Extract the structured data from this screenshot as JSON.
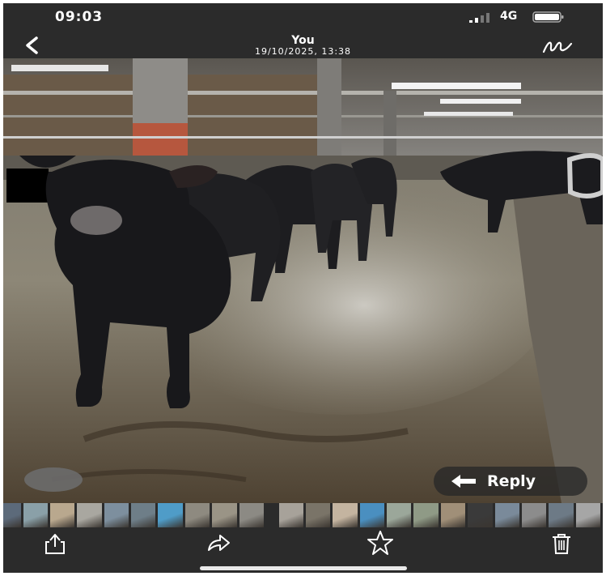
{
  "status_bar": {
    "time": "09:03",
    "network": "4G",
    "icons": [
      "signal-icon",
      "battery-icon"
    ]
  },
  "header": {
    "title": "You",
    "subtitle": "19/10/2025, 13:38",
    "back_icon": "chevron-left-icon",
    "markup_icon": "markup-icon"
  },
  "photo": {
    "description_icon": "photo-viewer-image"
  },
  "overlay": {
    "reply_label": "Reply",
    "reply_icon": "reply-arrow-icon"
  },
  "thumbnails": {
    "colors": [
      "#5c6a7a",
      "#8aa0a8",
      "#b9a88e",
      "#a9a7a0",
      "#7d8f9e",
      "#6e7e88",
      "#4f9cc8",
      "#8e8a80",
      "#9a9486",
      "#8c8a84",
      "#a7a29a",
      "#7a7468",
      "#c4b4a0",
      "#4a8fc0",
      "#9ba79a",
      "#8f9a86",
      "#a08f78",
      "#3a3a3a",
      "#7a8a9a",
      "#8c8c8c",
      "#6d7a86",
      "#a6a6a6"
    ],
    "selected_index": 10
  },
  "toolbar": {
    "share_icon": "share-icon",
    "forward_icon": "forward-icon",
    "star_icon": "star-icon",
    "delete_icon": "trash-icon"
  },
  "colors": {
    "background": "#2b2b2b",
    "text": "#ffffff"
  }
}
